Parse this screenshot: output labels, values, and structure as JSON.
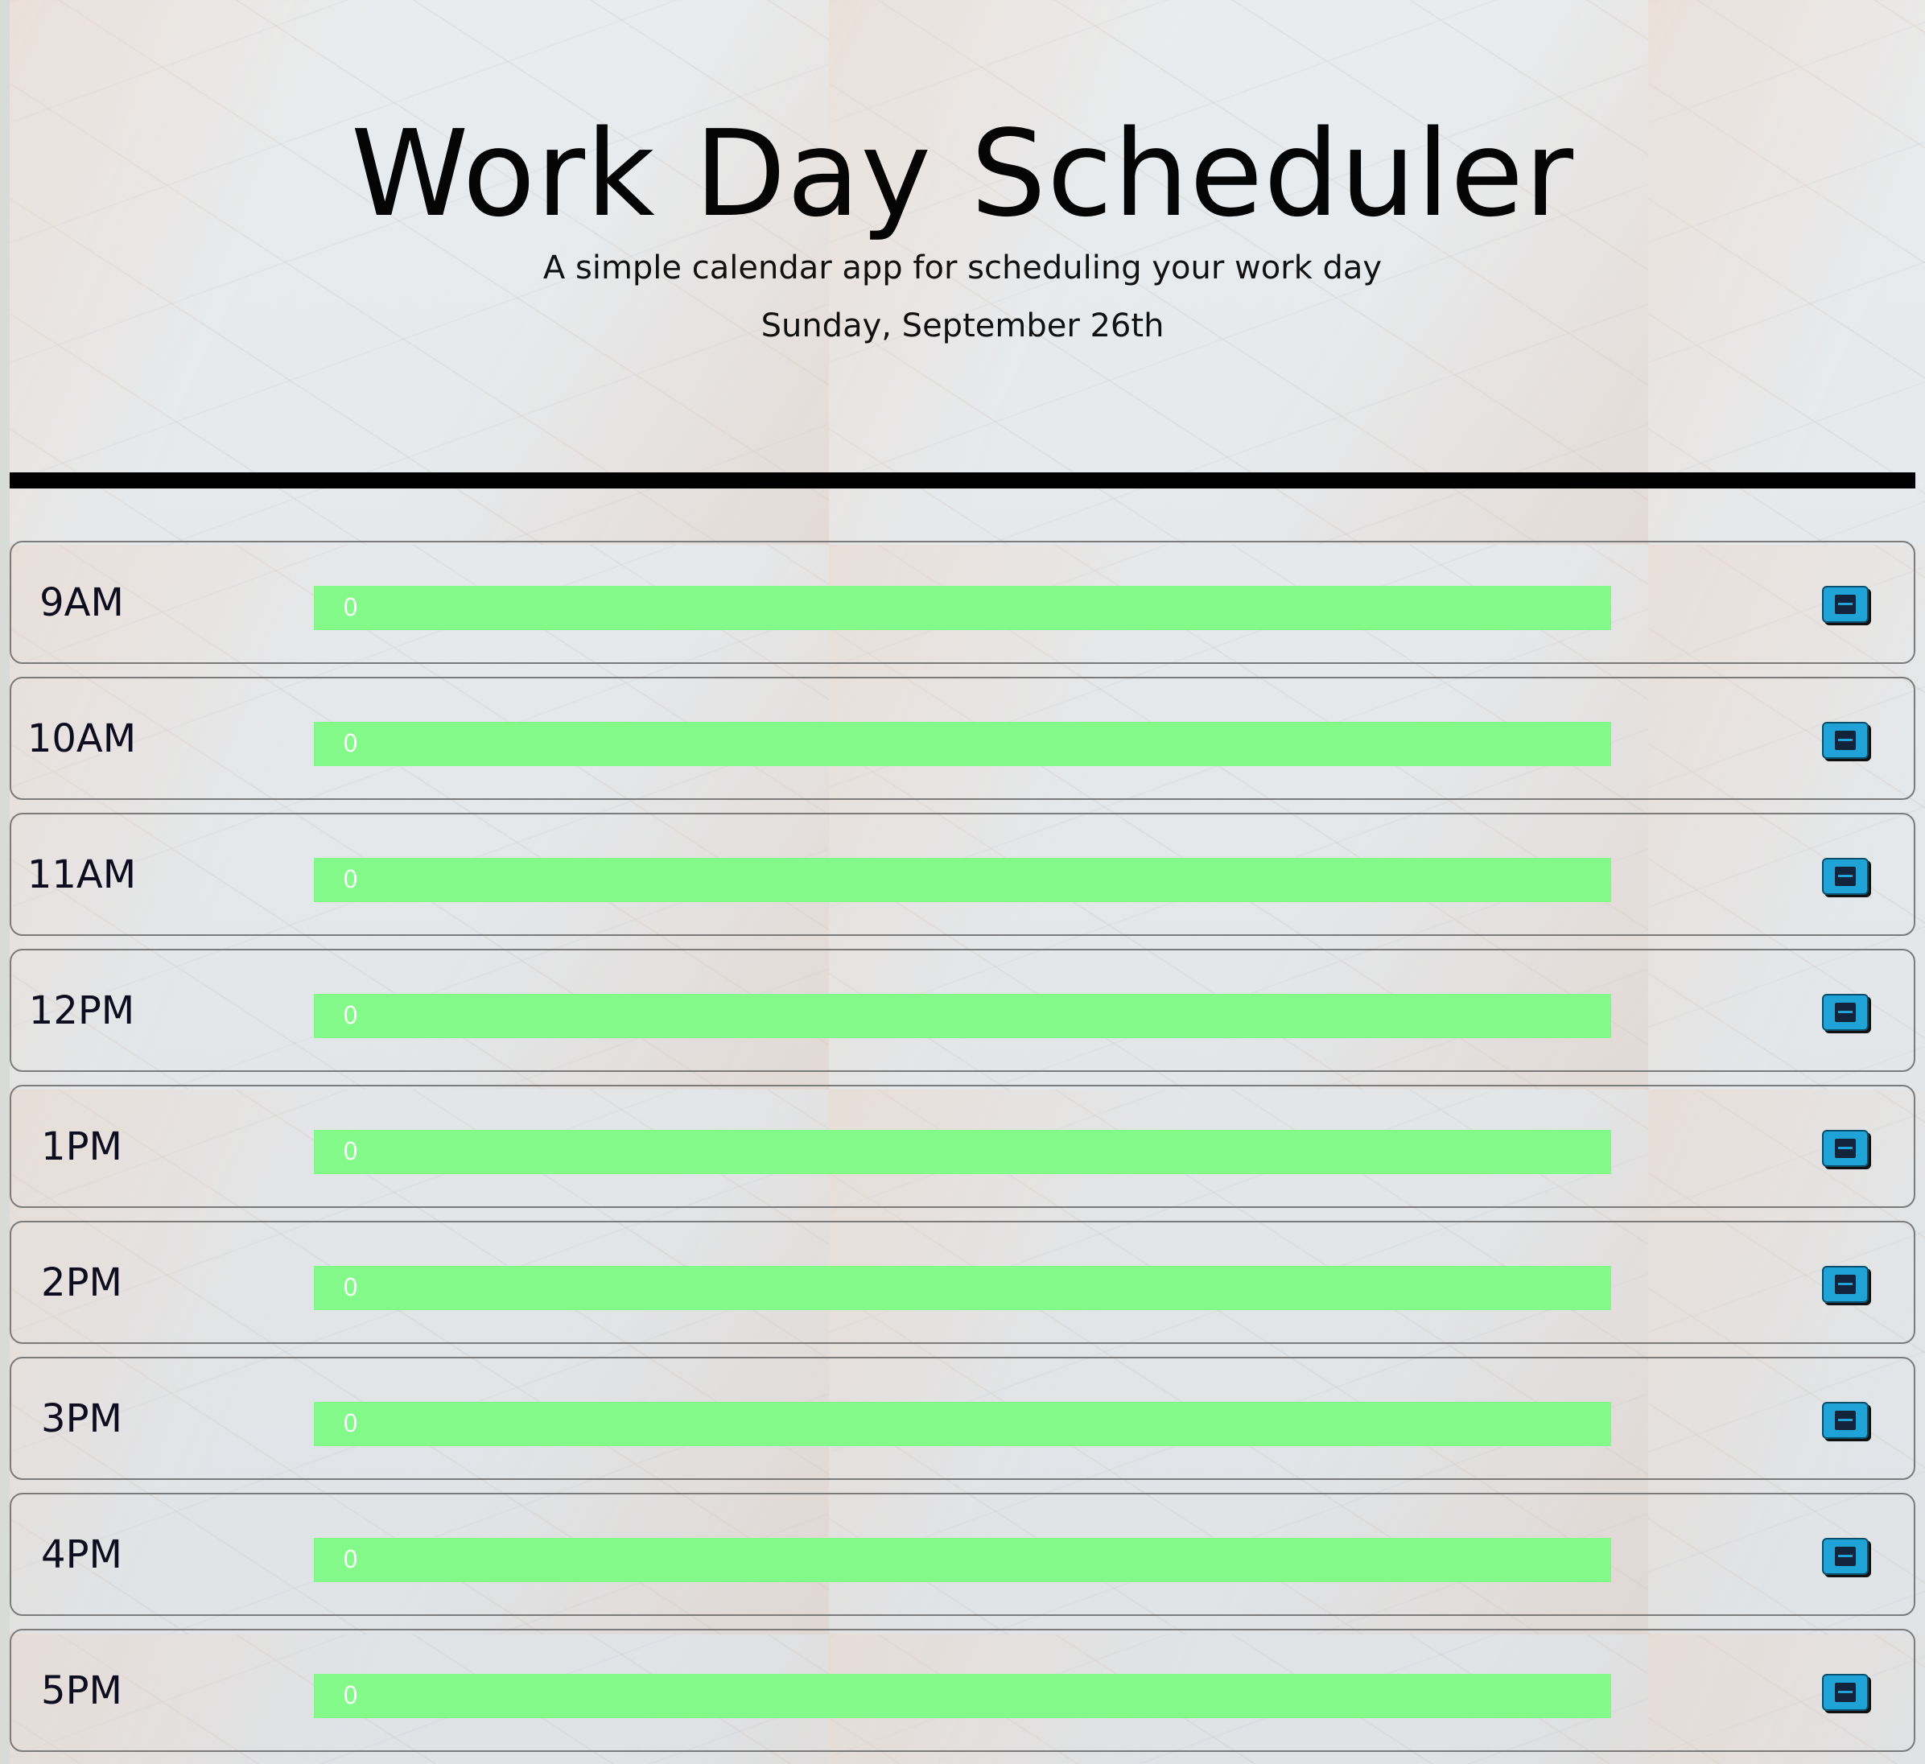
{
  "header": {
    "title": "Work Day Scheduler",
    "lead": "A simple calendar app for scheduling your work day",
    "current_day": "Sunday, September 26th"
  },
  "colors": {
    "present_row": "#82f989",
    "save_button": "#1fa2d6",
    "divider": "#000000"
  },
  "time_blocks": [
    {
      "hour": "9AM",
      "text": "0",
      "save_icon": "save-icon"
    },
    {
      "hour": "10AM",
      "text": "0",
      "save_icon": "save-icon"
    },
    {
      "hour": "11AM",
      "text": "0",
      "save_icon": "save-icon"
    },
    {
      "hour": "12PM",
      "text": "0",
      "save_icon": "save-icon"
    },
    {
      "hour": "1PM",
      "text": "0",
      "save_icon": "save-icon"
    },
    {
      "hour": "2PM",
      "text": "0",
      "save_icon": "save-icon"
    },
    {
      "hour": "3PM",
      "text": "0",
      "save_icon": "save-icon"
    },
    {
      "hour": "4PM",
      "text": "0",
      "save_icon": "save-icon"
    },
    {
      "hour": "5PM",
      "text": "0",
      "save_icon": "save-icon"
    }
  ]
}
